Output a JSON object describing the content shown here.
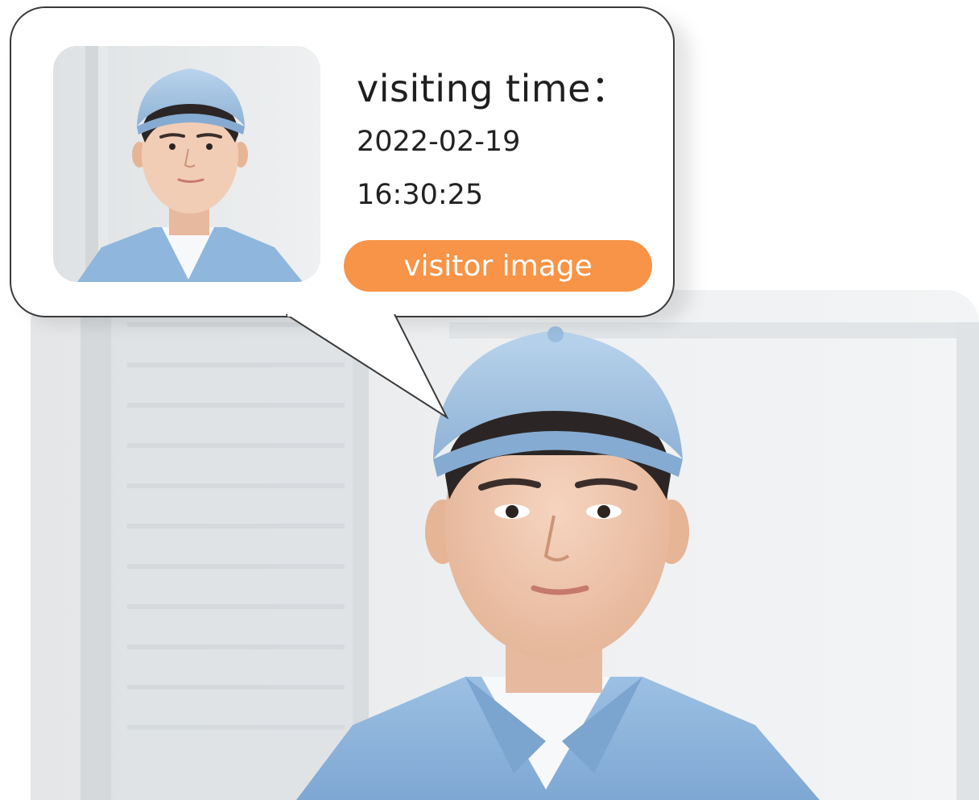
{
  "bubble": {
    "label": "visiting time：",
    "date": "2022-02-19",
    "time": "16:30:25",
    "badge_label": "visitor image"
  },
  "colors": {
    "badge": "#f79447",
    "cap": "#a9c9e6",
    "jacket": "#8fb6dd",
    "skin": "#f0c7ae",
    "bubble_border": "#3a3a3a"
  },
  "icons": {
    "thumbnail": "visitor-photo-thumbnail",
    "main_photo": "visitor-photo"
  }
}
